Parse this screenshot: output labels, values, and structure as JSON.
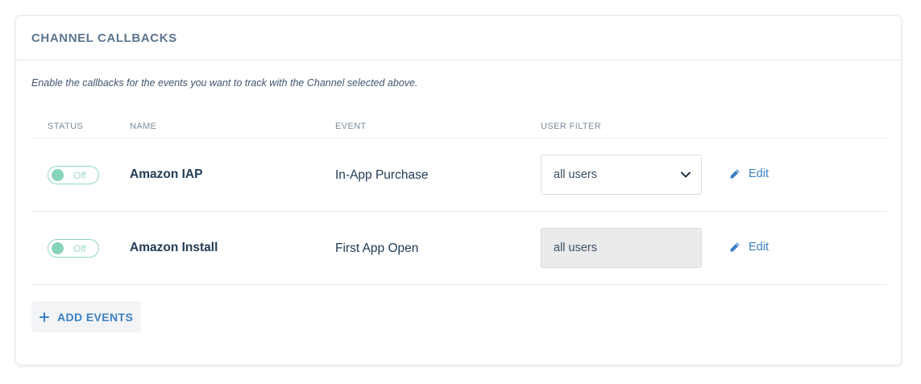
{
  "panel": {
    "title": "CHANNEL CALLBACKS",
    "description": "Enable the callbacks for the events you want to track with the Channel selected above."
  },
  "table": {
    "headers": {
      "status": "STATUS",
      "name": "NAME",
      "event": "EVENT",
      "user_filter": "USER FILTER"
    },
    "rows": [
      {
        "status": "Off",
        "name": "Amazon IAP",
        "event": "In-App Purchase",
        "user_filter": "all users",
        "filter_disabled": false,
        "edit_label": "Edit"
      },
      {
        "status": "Off",
        "name": "Amazon Install",
        "event": "First App Open",
        "user_filter": "all users",
        "filter_disabled": true,
        "edit_label": "Edit"
      }
    ]
  },
  "actions": {
    "add_events_label": "ADD EVENTS"
  },
  "icons": {
    "edit": "pencil-icon",
    "dropdown": "chevron-down-icon",
    "add": "plus-icon"
  },
  "colors": {
    "accent": "#3b7fc4",
    "toggle": "#86d3bc",
    "title": "#5c7590",
    "text": "#223c56"
  }
}
